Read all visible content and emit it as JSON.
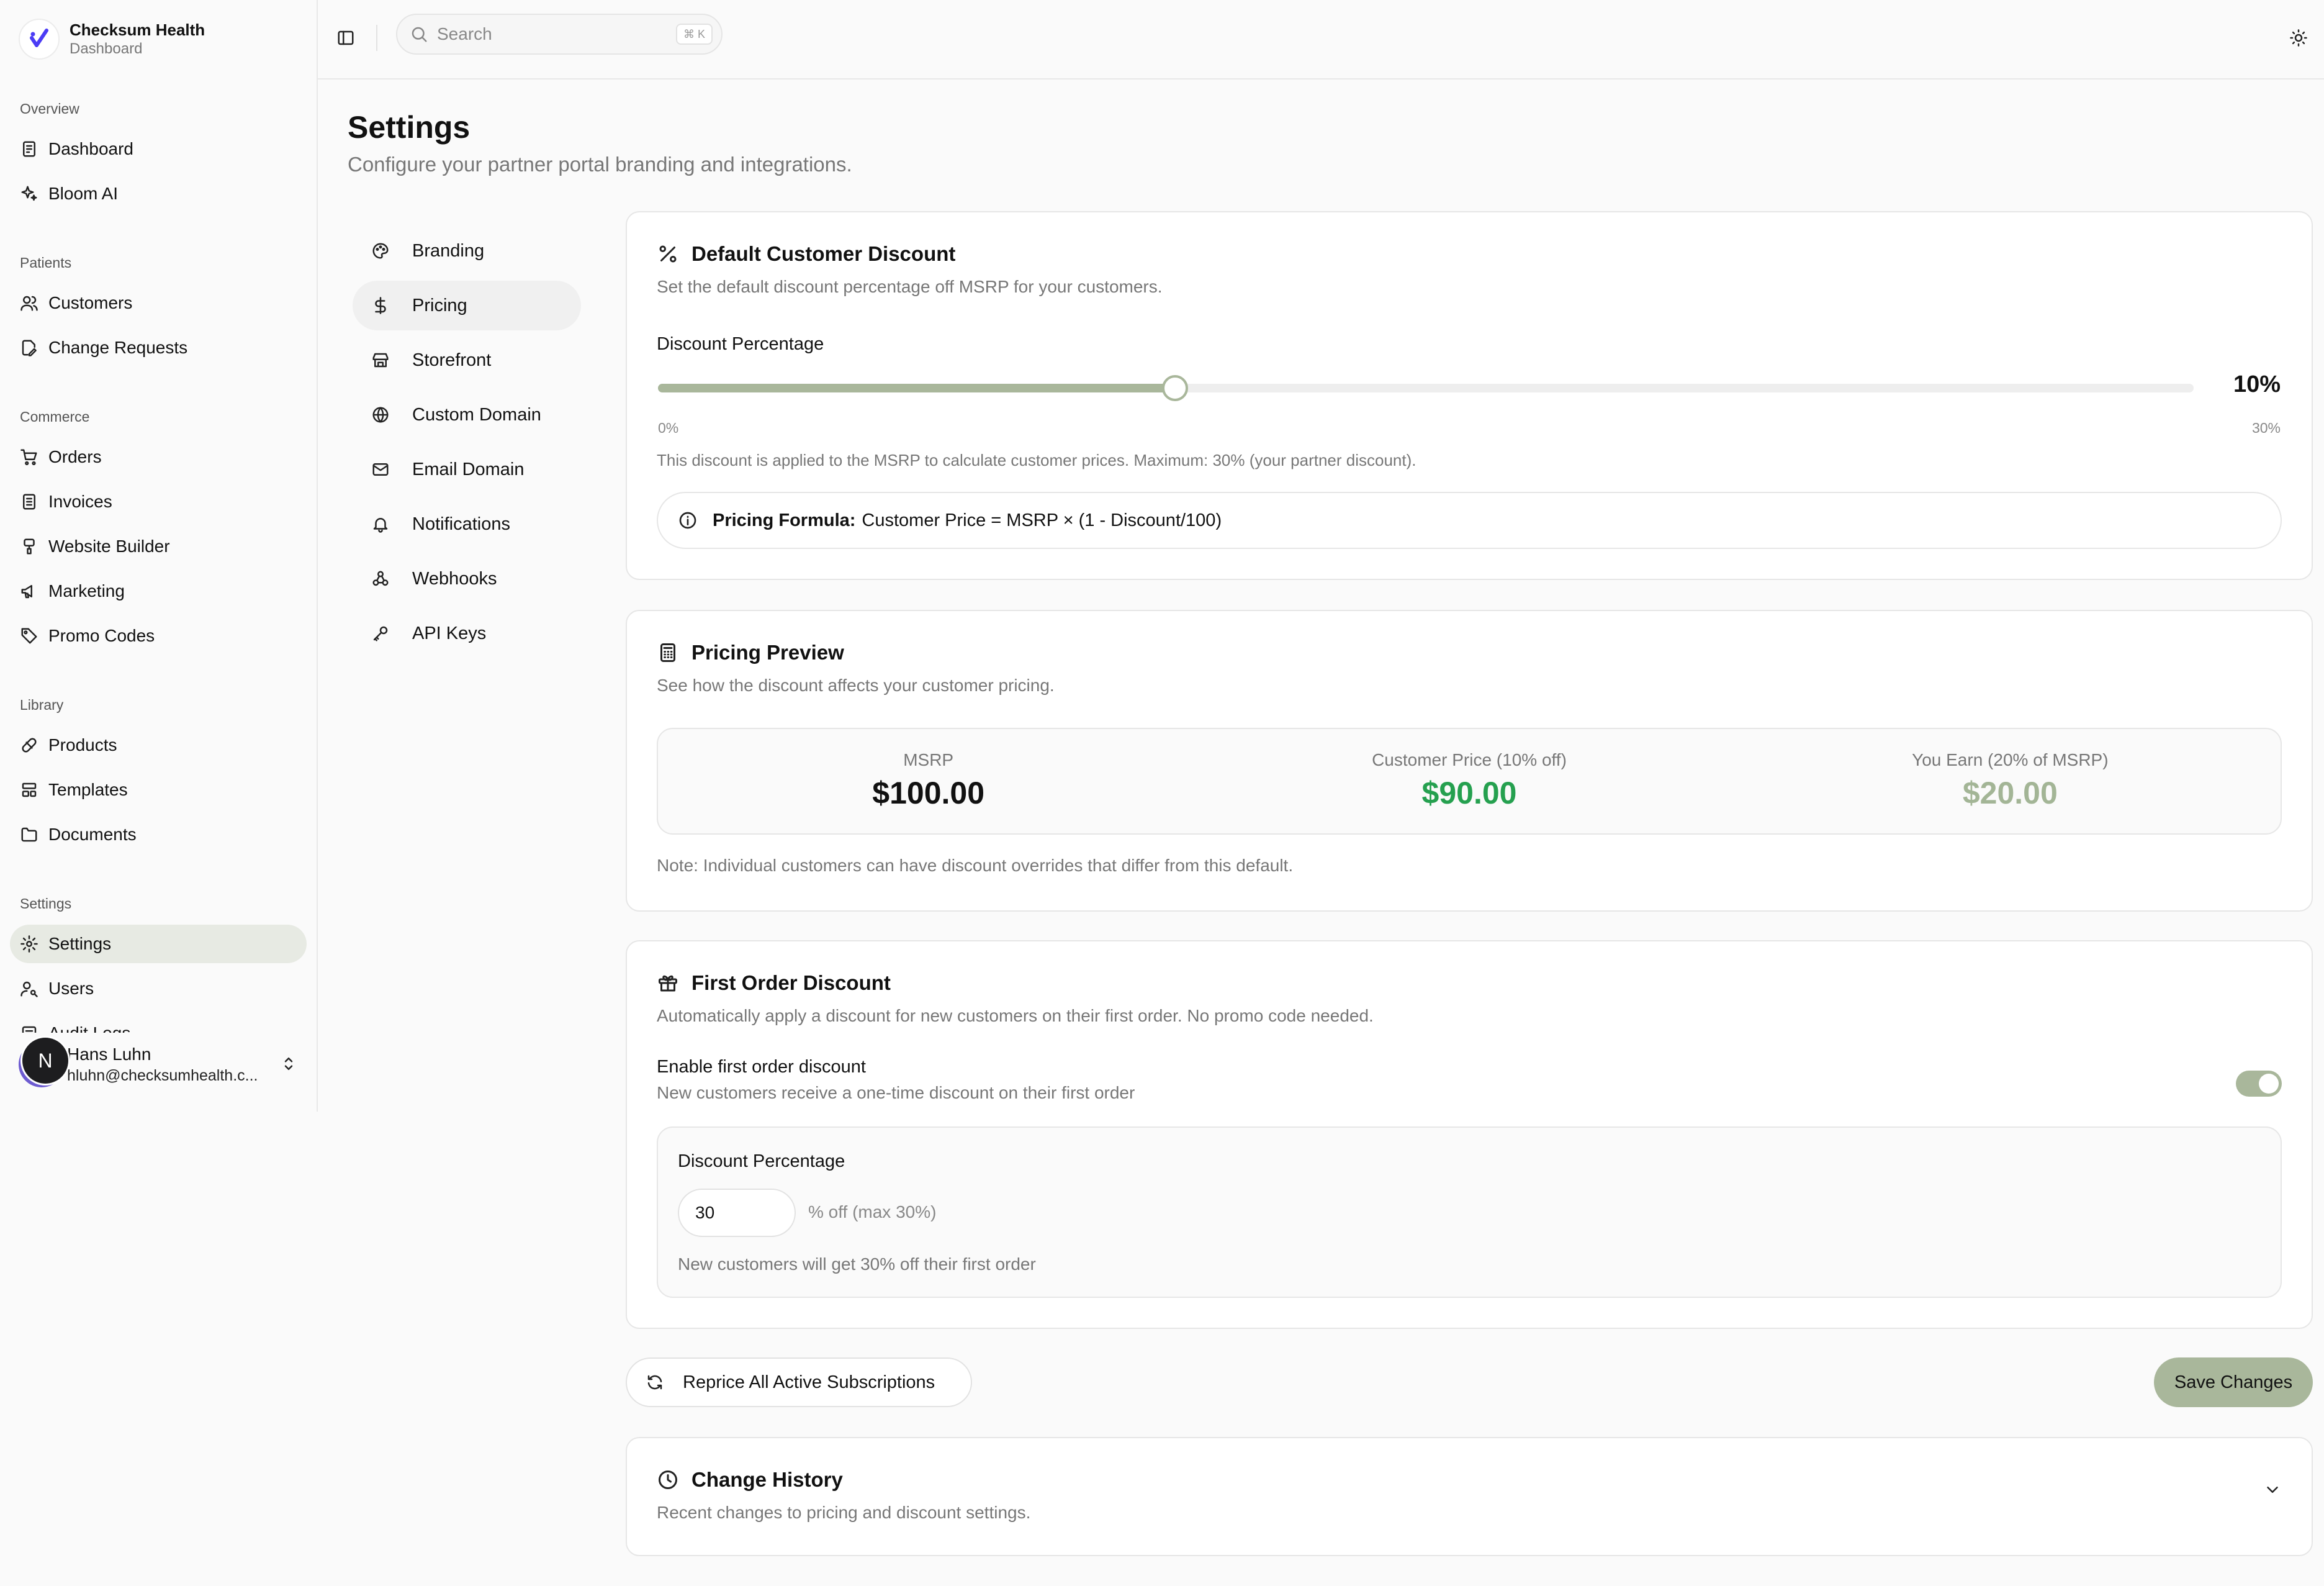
{
  "brand": {
    "name": "Checksum Health",
    "subtitle": "Dashboard"
  },
  "sidebar": {
    "groups": [
      {
        "label": "Overview",
        "items": [
          {
            "label": "Dashboard",
            "icon": "dashboard-icon"
          },
          {
            "label": "Bloom AI",
            "icon": "sparkles-icon"
          }
        ]
      },
      {
        "label": "Patients",
        "items": [
          {
            "label": "Customers",
            "icon": "users-icon"
          },
          {
            "label": "Change Requests",
            "icon": "file-edit-icon"
          }
        ]
      },
      {
        "label": "Commerce",
        "items": [
          {
            "label": "Orders",
            "icon": "cart-icon"
          },
          {
            "label": "Invoices",
            "icon": "invoice-icon"
          },
          {
            "label": "Website Builder",
            "icon": "brush-icon"
          },
          {
            "label": "Marketing",
            "icon": "megaphone-icon"
          },
          {
            "label": "Promo Codes",
            "icon": "tag-icon"
          }
        ]
      },
      {
        "label": "Library",
        "items": [
          {
            "label": "Products",
            "icon": "pill-icon"
          },
          {
            "label": "Templates",
            "icon": "layout-icon"
          },
          {
            "label": "Documents",
            "icon": "folder-icon"
          }
        ]
      },
      {
        "label": "Settings",
        "items": [
          {
            "label": "Settings",
            "icon": "gear-icon",
            "active": true
          },
          {
            "label": "Users",
            "icon": "user-key-icon"
          },
          {
            "label": "Audit Logs",
            "icon": "log-icon"
          }
        ]
      }
    ]
  },
  "user": {
    "initial": "N",
    "name": "Hans Luhn",
    "email": "hluhn@checksumhealth.c..."
  },
  "topbar": {
    "search_placeholder": "Search",
    "shortcut": "⌘ K"
  },
  "page": {
    "title": "Settings",
    "subtitle": "Configure your partner portal branding and integrations."
  },
  "subnav": [
    {
      "label": "Branding",
      "icon": "palette-icon"
    },
    {
      "label": "Pricing",
      "icon": "dollar-icon",
      "active": true
    },
    {
      "label": "Storefront",
      "icon": "store-icon"
    },
    {
      "label": "Custom Domain",
      "icon": "globe-icon"
    },
    {
      "label": "Email Domain",
      "icon": "mail-icon"
    },
    {
      "label": "Notifications",
      "icon": "bell-icon"
    },
    {
      "label": "Webhooks",
      "icon": "webhook-icon"
    },
    {
      "label": "API Keys",
      "icon": "key-icon"
    }
  ],
  "discount_card": {
    "title": "Default Customer Discount",
    "description": "Set the default discount percentage off MSRP for your customers.",
    "slider_label": "Discount Percentage",
    "value_text": "10%",
    "value_fraction": 0.3367,
    "min_label": "0%",
    "max_label": "30%",
    "help": "This discount is applied to the MSRP to calculate customer prices. Maximum: 30% (your partner discount).",
    "formula_label": "Pricing Formula:",
    "formula": "Customer Price = MSRP × (1 - Discount/100)"
  },
  "preview_card": {
    "title": "Pricing Preview",
    "description": "See how the discount affects your customer pricing.",
    "columns": [
      {
        "label": "MSRP",
        "value": "$100.00",
        "color": "#111111"
      },
      {
        "label": "Customer Price (10% off)",
        "value": "$90.00",
        "color": "#25a04f"
      },
      {
        "label": "You Earn (20% of MSRP)",
        "value": "$20.00",
        "color": "#a3b596"
      }
    ],
    "note": "Note: Individual customers can have discount overrides that differ from this default."
  },
  "first_order_card": {
    "title": "First Order Discount",
    "description": "Automatically apply a discount for new customers on their first order. No promo code needed.",
    "toggle_label": "Enable first order discount",
    "toggle_help": "New customers receive a one-time discount on their first order",
    "toggle_on": true,
    "input_label": "Discount Percentage",
    "input_value": "30",
    "input_suffix": "% off (max 30%)",
    "input_help": "New customers will get 30% off their first order"
  },
  "actions": {
    "reprice_label": "Reprice All Active Subscriptions",
    "save_label": "Save Changes"
  },
  "history_card": {
    "title": "Change History",
    "description": "Recent changes to pricing and discount settings."
  },
  "colors": {
    "accent": "#a9b79b",
    "active_bg": "#e7eae3",
    "green": "#25a04f"
  }
}
